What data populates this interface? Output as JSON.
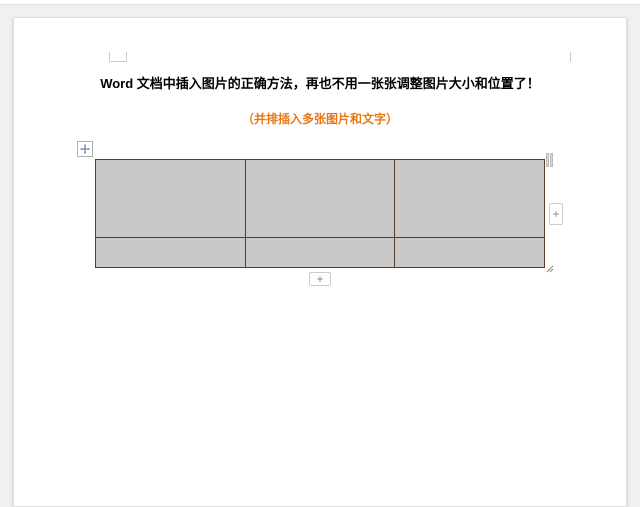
{
  "document": {
    "title": "Word 文档中插入图片的正确方法，再也不用一张张调整图片大小和位置了！",
    "subtitle": "（并排插入多张图片和文字）"
  },
  "table": {
    "rows": 2,
    "cols": 3,
    "add_row_label": "+",
    "add_col_label": "+"
  },
  "colors": {
    "subtitle": "#e67817",
    "table_border": "#5a3a2a",
    "table_fill": "#c8c8c8"
  }
}
